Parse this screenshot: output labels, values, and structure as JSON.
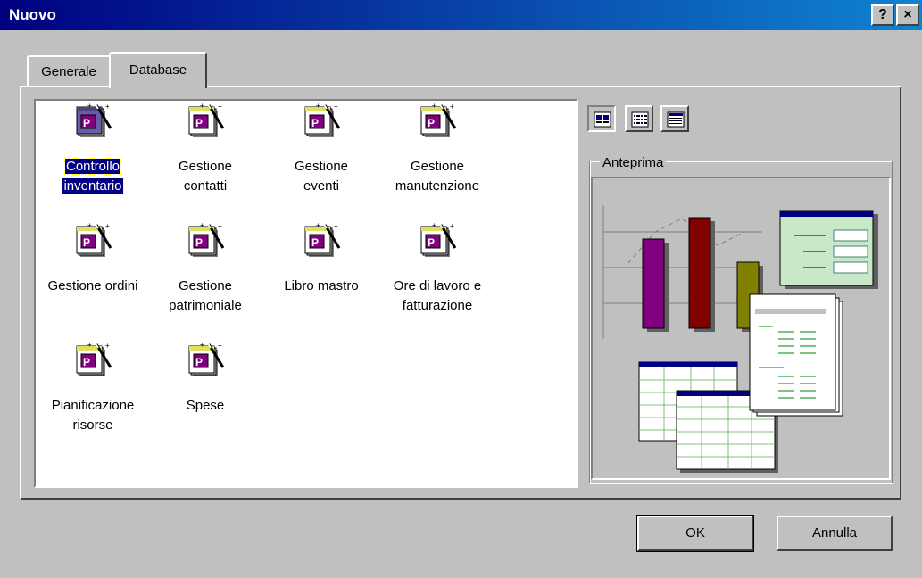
{
  "window": {
    "title": "Nuovo",
    "help_label": "?",
    "close_label": "×"
  },
  "tabs": [
    {
      "label": "Generale",
      "active": false
    },
    {
      "label": "Database",
      "active": true
    }
  ],
  "templates": [
    {
      "line1": "Controllo",
      "line2": "inventario",
      "selected": true
    },
    {
      "line1": "Gestione",
      "line2": "contatti"
    },
    {
      "line1": "Gestione",
      "line2": "eventi"
    },
    {
      "line1": "Gestione",
      "line2": "manutenzione"
    },
    {
      "line1": "Gestione ordini",
      "line2": ""
    },
    {
      "line1": "Gestione",
      "line2": "patrimoniale"
    },
    {
      "line1": "Libro mastro",
      "line2": ""
    },
    {
      "line1": "Ore di lavoro e",
      "line2": "fatturazione"
    },
    {
      "line1": "Pianificazione",
      "line2": "risorse"
    },
    {
      "line1": "Spese",
      "line2": ""
    }
  ],
  "view_buttons": [
    "large-icons-icon",
    "list-icon",
    "details-icon"
  ],
  "preview": {
    "label": "Anteprima"
  },
  "buttons": {
    "ok": "OK",
    "cancel": "Annulla"
  },
  "colors": {
    "titlebar_start": "#00007f",
    "titlebar_end": "#1084d0",
    "selection": "#000080"
  }
}
